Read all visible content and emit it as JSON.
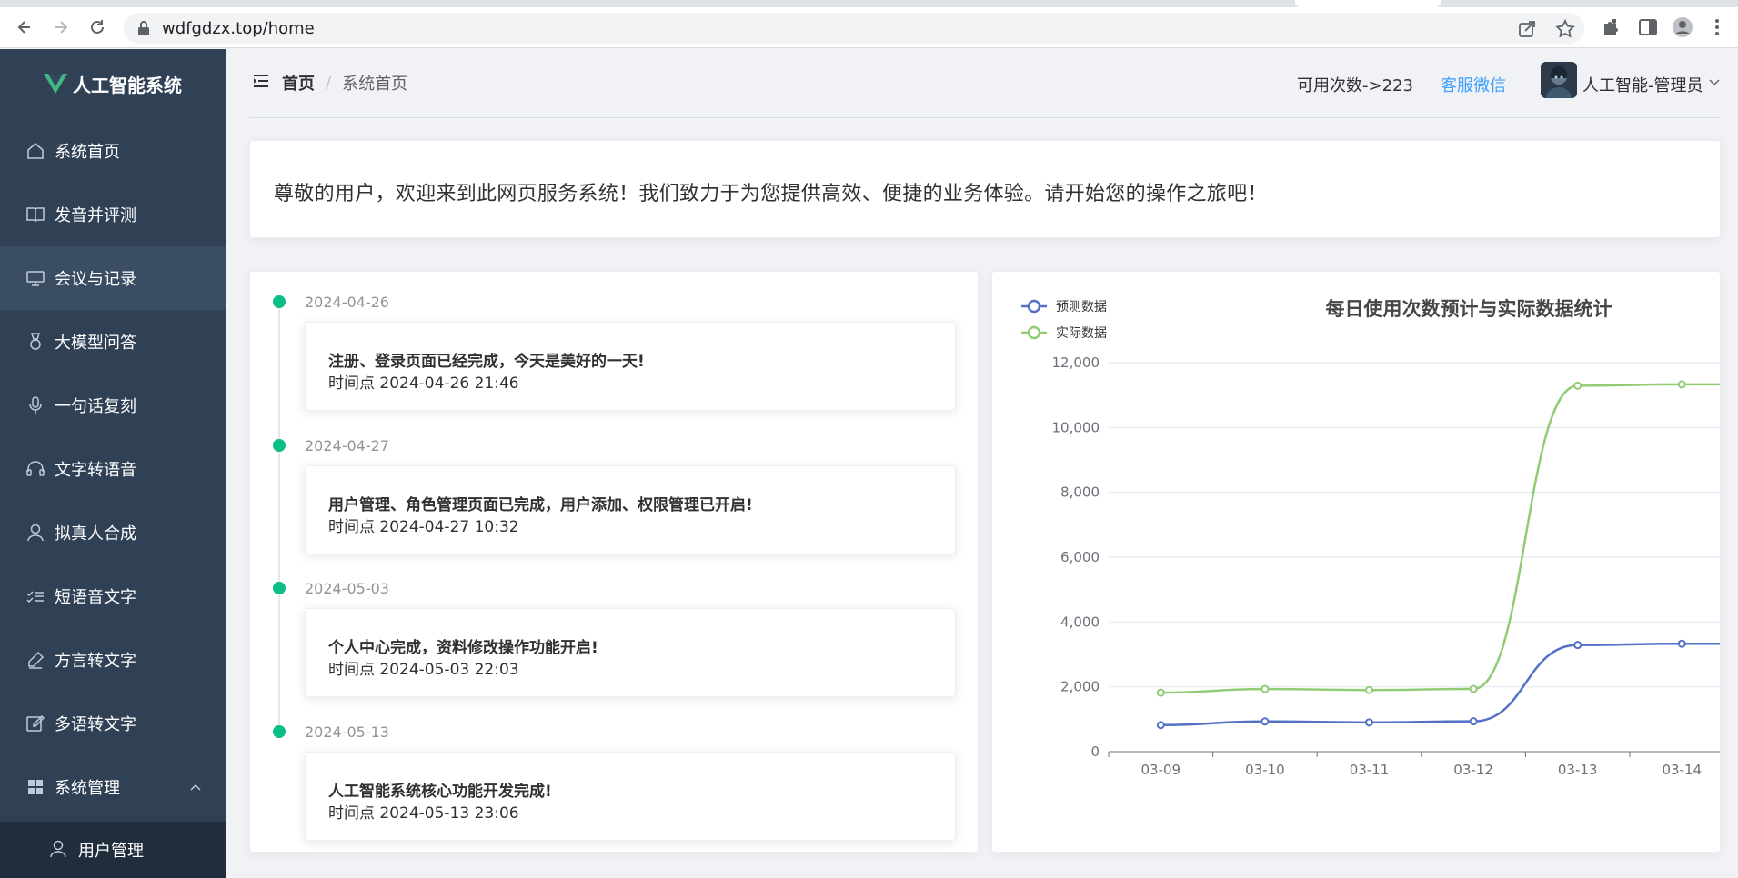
{
  "browser": {
    "url": "wdfgdzx.top/home"
  },
  "sidebar": {
    "logo_text": "人工智能系统",
    "items": [
      {
        "label": "系统首页",
        "icon": "house-icon"
      },
      {
        "label": "发音并评测",
        "icon": "book-icon"
      },
      {
        "label": "会议与记录",
        "icon": "monitor-icon"
      },
      {
        "label": "大模型问答",
        "icon": "medal-icon"
      },
      {
        "label": "一句话复刻",
        "icon": "microphone-icon"
      },
      {
        "label": "文字转语音",
        "icon": "headset-icon"
      },
      {
        "label": "拟真人合成",
        "icon": "user-icon"
      },
      {
        "label": "短语音文字",
        "icon": "list-check-icon"
      },
      {
        "label": "方言转文字",
        "icon": "pen-icon"
      },
      {
        "label": "多语转文字",
        "icon": "edit-icon"
      },
      {
        "label": "系统管理",
        "icon": "grid-icon"
      }
    ],
    "submenu": [
      {
        "label": "用户管理",
        "icon": "user-icon"
      }
    ]
  },
  "header": {
    "breadcrumb_home": "首页",
    "breadcrumb_sep": "/",
    "breadcrumb_current": "系统首页",
    "usage_count": "可用次数->223",
    "service_link": "客服微信",
    "user_name": "人工智能-管理员"
  },
  "welcome": {
    "text": "尊敬的用户，欢迎来到此网页服务系统！我们致力于为您提供高效、便捷的业务体验。请开始您的操作之旅吧！"
  },
  "timeline": [
    {
      "date": "2024-04-26",
      "title": "注册、登录页面已经完成，今天是美好的一天!",
      "time": "时间点 2024-04-26 21:46"
    },
    {
      "date": "2024-04-27",
      "title": "用户管理、角色管理页面已完成，用户添加、权限管理已开启!",
      "time": "时间点 2024-04-27 10:32"
    },
    {
      "date": "2024-05-03",
      "title": "个人中心完成，资料修改操作功能开启!",
      "time": "时间点 2024-05-03 22:03"
    },
    {
      "date": "2024-05-13",
      "title": "人工智能系统核心功能开发完成!",
      "time": "时间点 2024-05-13 23:06"
    }
  ],
  "colors": {
    "sidebar_bg": "#304156",
    "timeline_node": "#0bbd87",
    "link": "#409eff",
    "series_predicted": "#5470c6",
    "series_actual": "#91cc75"
  },
  "chart_data": {
    "type": "line",
    "title": "每日使用次数预计与实际数据统计",
    "categories": [
      "03-09",
      "03-10",
      "03-11",
      "03-12",
      "03-13",
      "03-14"
    ],
    "series": [
      {
        "name": "预测数据",
        "values": [
          820,
          932,
          901,
          934,
          3290,
          3330
        ]
      },
      {
        "name": "实际数据",
        "values": [
          1820,
          1932,
          1901,
          1934,
          11290,
          11330
        ]
      }
    ],
    "ylim": [
      0,
      12000
    ],
    "yticks": [
      0,
      2000,
      4000,
      6000,
      8000,
      10000,
      12000
    ],
    "ytick_labels": [
      "0",
      "2,000",
      "4,000",
      "6,000",
      "8,000",
      "10,000",
      "12,000"
    ],
    "smooth": true,
    "grid": "horizontal",
    "legend": "top-left"
  }
}
